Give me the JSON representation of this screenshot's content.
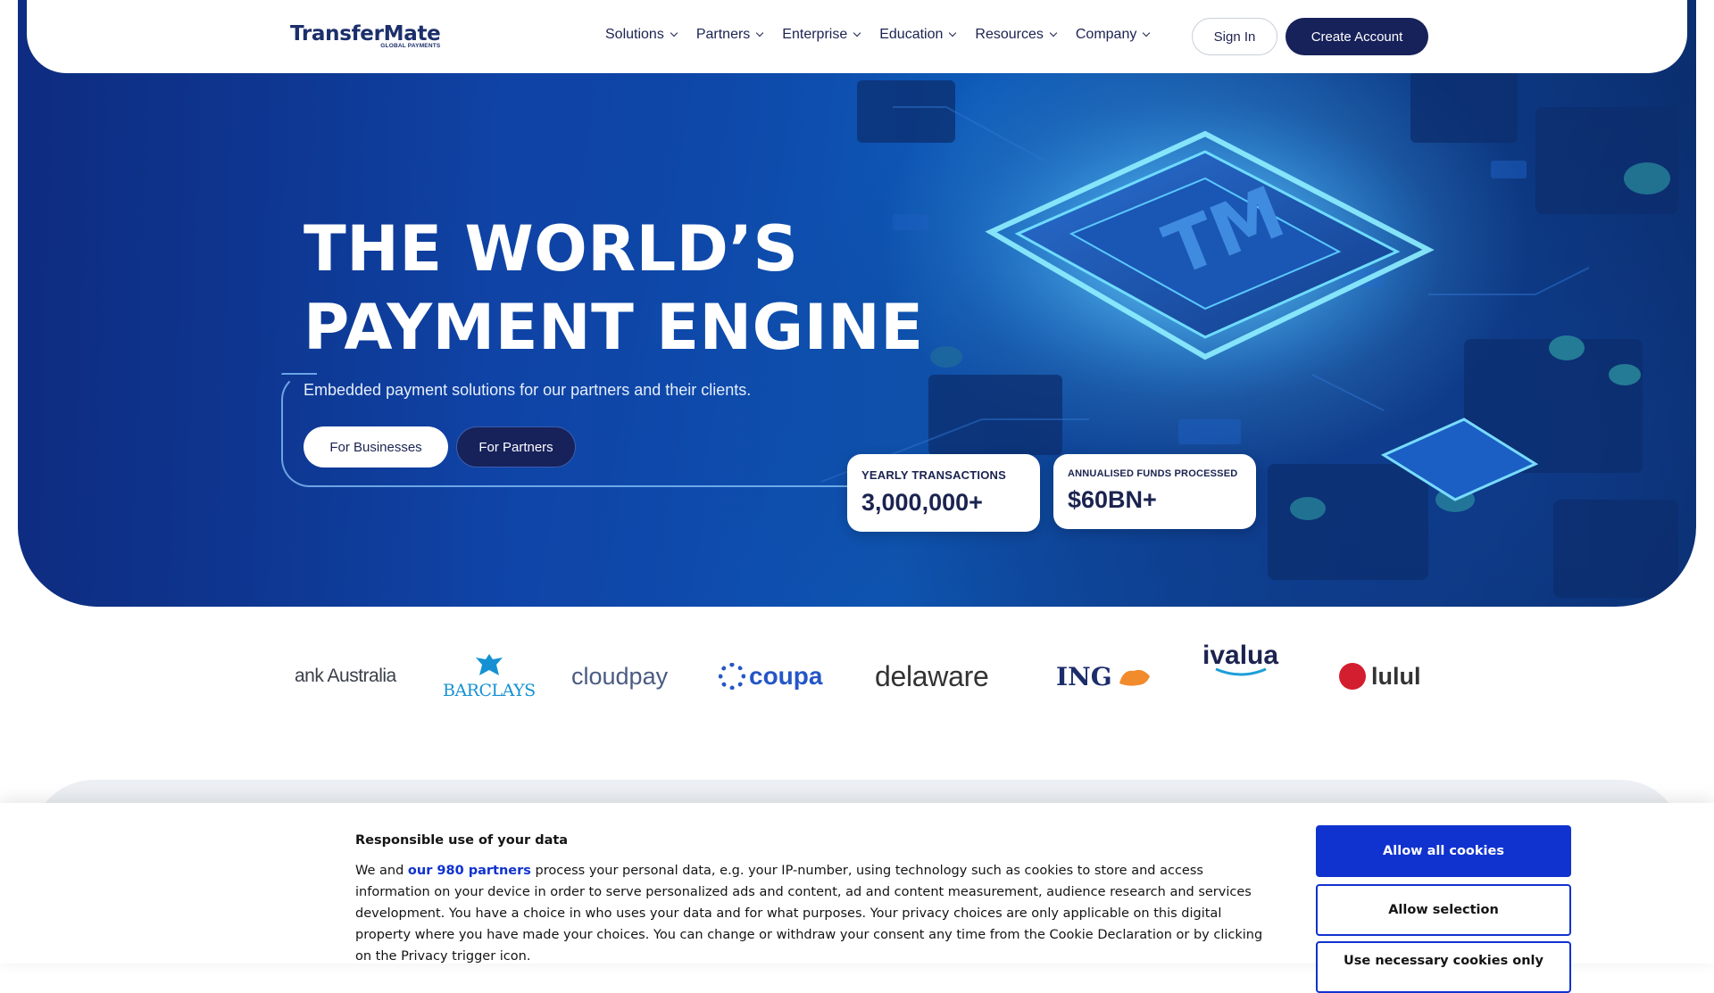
{
  "nav": {
    "logo_word": "TransferMate",
    "logo_tag": "GLOBAL PAYMENTS",
    "menu": [
      {
        "label": "Solutions"
      },
      {
        "label": "Partners"
      },
      {
        "label": "Enterprise"
      },
      {
        "label": "Education"
      },
      {
        "label": "Resources"
      },
      {
        "label": "Company"
      }
    ],
    "sign_in": "Sign In",
    "create_account": "Create Account"
  },
  "hero": {
    "title_line1": "THE WORLD’S",
    "title_line2": "PAYMENT ENGINE",
    "subtitle": "Embedded payment solutions for our partners and their clients.",
    "btn_businesses": "For Businesses",
    "btn_partners": "For Partners",
    "chip_text": "TM",
    "stats": [
      {
        "label": "YEARLY TRANSACTIONS",
        "value": "3,000,000+"
      },
      {
        "label": "ANNUALISED FUNDS PROCESSED",
        "value": "$60BN+"
      }
    ]
  },
  "partners_strip": [
    "ank Australia",
    "BARCLAYS",
    "cloudpay",
    "coupa",
    "delaware",
    "ING",
    "ivalua",
    "lulul"
  ],
  "cookie": {
    "title": "Responsible use of your data",
    "text_before": "We and ",
    "link": "our 980 partners",
    "text_after": " process your personal data, e.g. your IP-number, using technology such as cookies to store and access information on your device in order to serve personalized ads and content, ad and content measurement, audience research and services development. You have a choice in who uses your data and for what purposes. Your privacy choices are only applicable on this digital property where you have made your choices. You can change or withdraw your consent any time from the Cookie Declaration or by clicking on the Privacy trigger icon.",
    "btn_allow_all": "Allow all cookies",
    "btn_allow_selection": "Allow selection",
    "btn_third": "Use necessary cookies only"
  },
  "colors": {
    "navy": "#17215a",
    "brand_blue": "#1032cf",
    "hero_blue": "#0e5ab8",
    "barclays": "#1591d3",
    "coupa": "#2456c6"
  }
}
